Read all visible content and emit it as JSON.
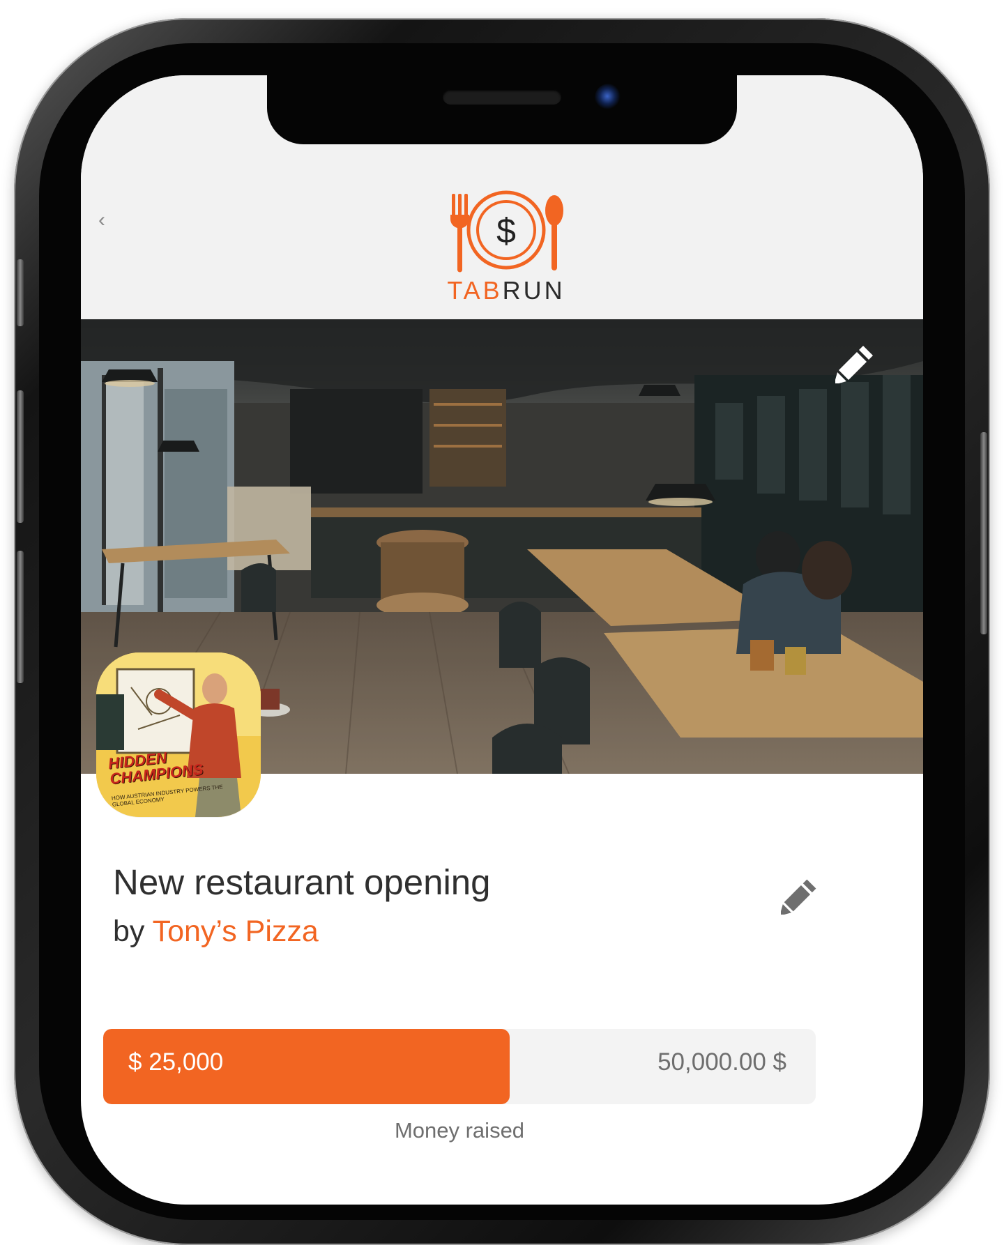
{
  "app": {
    "brand_prefix": "TAB",
    "brand_suffix": "RUN",
    "accent_color": "#f26522"
  },
  "header": {
    "back_label": "‹"
  },
  "hero": {
    "image": "restaurant-interior-photo",
    "edit_icon": "pencil-icon"
  },
  "avatar": {
    "title_line1": "HIDDEN",
    "title_line2": "CHAMPIONS",
    "subtitle": "HOW AUSTRIAN INDUSTRY POWERS THE GLOBAL ECONOMY"
  },
  "campaign": {
    "title": "New restaurant opening",
    "by_prefix": "by ",
    "organizer": "Tony’s Pizza",
    "edit_icon": "pencil-icon"
  },
  "progress": {
    "raised_label": "$ 25,000",
    "goal_label": "50,000.00 $",
    "fraction": 0.57,
    "caption": "Money raised"
  }
}
